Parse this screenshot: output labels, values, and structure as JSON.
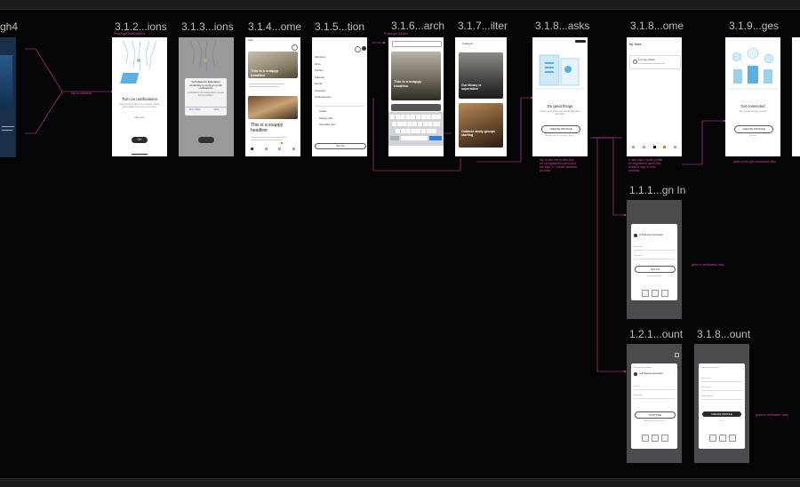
{
  "frames": {
    "f0": {
      "label": "gh4"
    },
    "f1": {
      "label": "3.1.2...ions",
      "title": "Turn on notifications",
      "body": "Stay informed about new content, events and updates from your community.",
      "link": "Not now",
      "button": "OK"
    },
    "f2": {
      "label": "3.1.3...ions",
      "dialog_title": "\"Jeff Measure Education\" would like to send you push notifications",
      "dialog_body": "Notifications may include alerts, sounds and icon badges.",
      "deny": "Don't Allow",
      "allow": "Allow"
    },
    "f3": {
      "label": "3.1.4...ome",
      "headline1": "This is a snappy headline",
      "headline2": "This is a snappy headline"
    },
    "f4": {
      "label": "3.1.5...tion",
      "menu_items": [
        "Abonnees",
        "Inbox",
        "Contact",
        "Kalender",
        "Events",
        "Programs",
        "Ondersteuning"
      ],
      "sub_items": [
        "Update",
        "Settings Help",
        "Information Item"
      ],
      "footer_button": "Sign Out"
    },
    "f5": {
      "label": "3.1.6...arch",
      "headline": "This is a snappy headline"
    },
    "f6": {
      "label": "3.1.7...ilter",
      "card1_title": "Our library is superlative",
      "card2_title": "Outdoor study groups starting",
      "header": "Category"
    },
    "f7": {
      "label": "3.1.8...asks",
      "title": "Do great things",
      "body": "Create your profile to get started with tasks and goals",
      "button": "CREATE PROFILE",
      "link": "Already have an account? Sign in"
    },
    "f8": {
      "label": "3.1.8...ome",
      "header": "My Tasks",
      "task": "Let's get started"
    },
    "f9": {
      "label": "3.1.9...ges",
      "title": "Get connected",
      "body": "Join groups and stay in touch",
      "button": "CREATE PROFILE",
      "link": "Not now"
    },
    "f10": {
      "label": "1.1.1...gn In",
      "school": "Jeff Measure Education",
      "field1": "Username",
      "field2": "Password",
      "button": "SIGN IN",
      "link": "Forgot password?"
    },
    "f11": {
      "label": "1.2.1...ount",
      "school": "Jeff Measure Education",
      "field1": "Email",
      "field2": "Password",
      "button": "CONTINUE",
      "link": "Already have an account?"
    },
    "f12": {
      "label": "3.1.8...ount",
      "field1": "First name",
      "field2": "Last name",
      "field3": "Email address",
      "button": "CREATE PROFILE",
      "link": "Terms"
    }
  },
  "notes": {
    "n1": "tap to continue",
    "n2": "Prototype Notifications",
    "n3": "Prototype Search",
    "n4": "tap to see the profile flow\nfor unregistered users and\nthe sign in / create account\nprocess",
    "n5": "if user taps create profile\nfor registered users this\nleads to sign in flow\nprocess",
    "n6": "goes to the get connected step",
    "n7": "goes to verification step",
    "n8": "goes to verification step"
  },
  "colors": {
    "canvas": "#050505",
    "wire": "#e040b0",
    "frame_dark": "#4a4a4f",
    "accent_blue": "#5ab0e0",
    "accent_orange": "#e87a2a"
  }
}
